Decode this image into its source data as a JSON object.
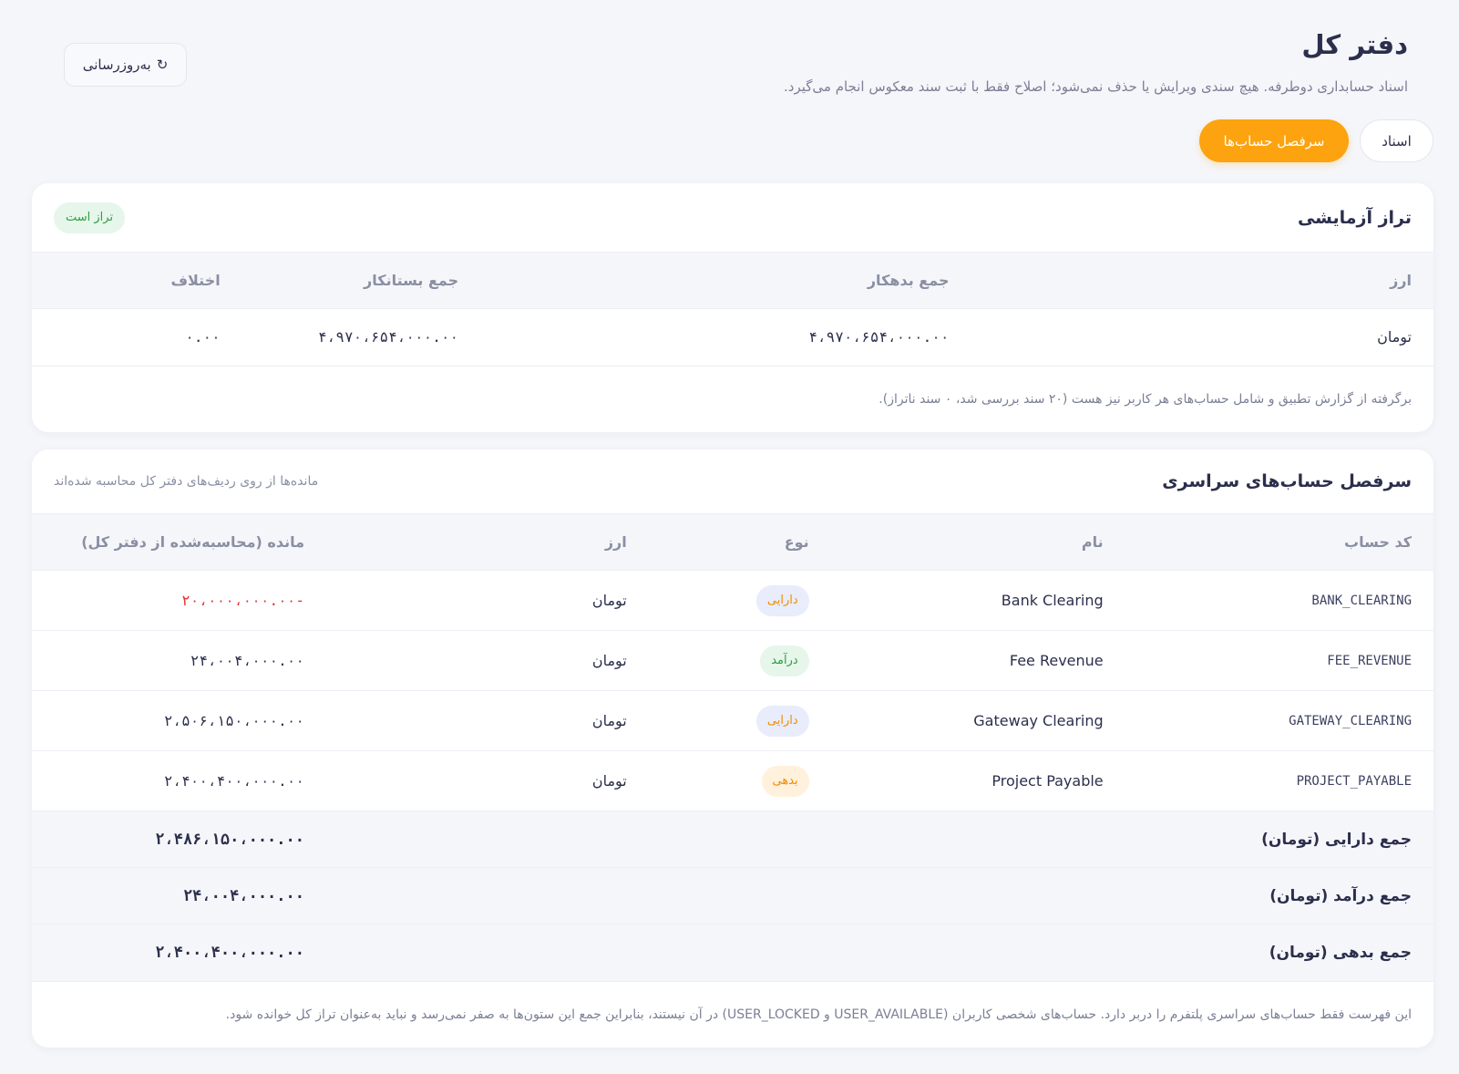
{
  "header": {
    "title": "دفتر کل",
    "subtitle": "اسناد حسابداری دوطرفه. هیچ سندی ویرایش یا حذف نمی‌شود؛ اصلاح فقط با ثبت سند معکوس انجام می‌گیرد.",
    "refresh_label": "به‌روزرسانی",
    "refresh_icon": "↻"
  },
  "tabs": [
    {
      "label": "اسناد",
      "active": false
    },
    {
      "label": "سرفصل حساب‌ها",
      "active": true
    }
  ],
  "trial_balance": {
    "title": "تراز آزمایشی",
    "status_badge": "تراز است",
    "columns": [
      "ارز",
      "جمع بدهکار",
      "جمع بستانکار",
      "اختلاف"
    ],
    "rows": [
      {
        "currency": "تومان",
        "debit": "۴،۹۷۰،۶۵۴،۰۰۰.۰۰",
        "credit": "۴،۹۷۰،۶۵۴،۰۰۰.۰۰",
        "difference": "۰.۰۰"
      }
    ],
    "note": "برگرفته از گزارش تطبیق و شامل حساب‌های هر کاربر نیز هست (۲۰ سند بررسی شد، ۰ سند ناتراز)."
  },
  "accounts": {
    "title": "سرفصل حساب‌های سراسری",
    "head_note": "مانده‌ها از روی ردیف‌های دفتر کل محاسبه شده‌اند",
    "columns": [
      "کد حساب",
      "نام",
      "نوع",
      "ارز",
      "مانده (محاسبه‌شده از دفتر کل)"
    ],
    "rows": [
      {
        "code": "BANK_CLEARING",
        "name": "Bank Clearing",
        "type": "دارایی",
        "currency": "تومان",
        "balance": "-۲۰،۰۰۰،۰۰۰.۰۰"
      },
      {
        "code": "FEE_REVENUE",
        "name": "Fee Revenue",
        "type": "درآمد",
        "currency": "تومان",
        "balance": "۲۴،۰۰۴،۰۰۰.۰۰"
      },
      {
        "code": "GATEWAY_CLEARING",
        "name": "Gateway Clearing",
        "type": "دارایی",
        "currency": "تومان",
        "balance": "۲،۵۰۶،۱۵۰،۰۰۰.۰۰"
      },
      {
        "code": "PROJECT_PAYABLE",
        "name": "Project Payable",
        "type": "بدهی",
        "currency": "تومان",
        "balance": "۲،۴۰۰،۴۰۰،۰۰۰.۰۰"
      }
    ],
    "totals": [
      {
        "label": "جمع دارایی (تومان)",
        "value": "۲،۴۸۶،۱۵۰،۰۰۰.۰۰"
      },
      {
        "label": "جمع درآمد (تومان)",
        "value": "۲۴،۰۰۴،۰۰۰.۰۰"
      },
      {
        "label": "جمع بدهی (تومان)",
        "value": "۲،۴۰۰،۴۰۰،۰۰۰.۰۰"
      }
    ],
    "note": "این فهرست فقط حساب‌های سراسری پلتفرم را دربر دارد. حساب‌های شخصی کاربران (USER_AVAILABLE و USER_LOCKED) در آن نیستند، بنابراین جمع این ستون‌ها به صفر نمی‌رسد و نباید به‌عنوان تراز کل خوانده شود."
  },
  "colors": {
    "accent": "#fca30f",
    "success": "#2f9e44",
    "negative": "#e03131"
  }
}
